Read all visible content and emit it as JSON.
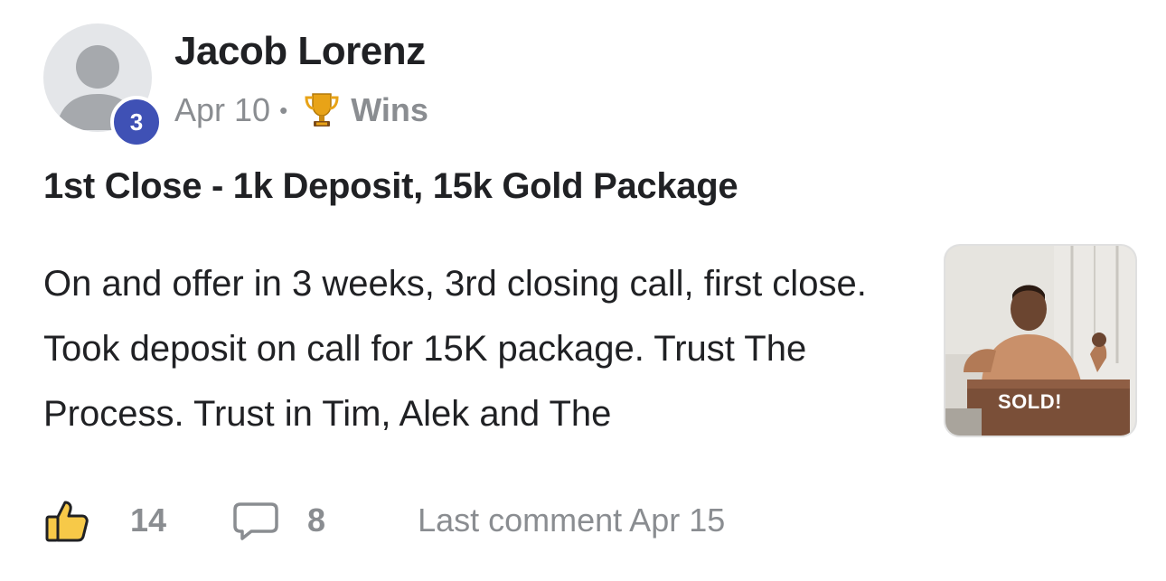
{
  "post": {
    "author": {
      "name": "Jacob Lorenz",
      "level": "3",
      "avatar_icon": "default-user-silhouette"
    },
    "meta": {
      "date": "Apr 10",
      "separator": "•",
      "category_icon": "trophy-icon",
      "category": "Wins"
    },
    "title": "1st Close - 1k Deposit, 15k Gold Package",
    "body": "On and offer in 3 weeks, 3rd closing call, first close. Took deposit on call for 15K package. Trust The Process. Trust in Tim, Alek and The",
    "thumbnail": {
      "caption": "SOLD!"
    },
    "footer": {
      "like_icon": "thumbs-up-icon",
      "likes": "14",
      "comment_icon": "speech-bubble-icon",
      "comments": "8",
      "last_comment": "Last comment Apr 15"
    },
    "colors": {
      "badge": "#3f51b5",
      "muted": "#8a8d91",
      "like_fill": "#f7c948"
    }
  }
}
